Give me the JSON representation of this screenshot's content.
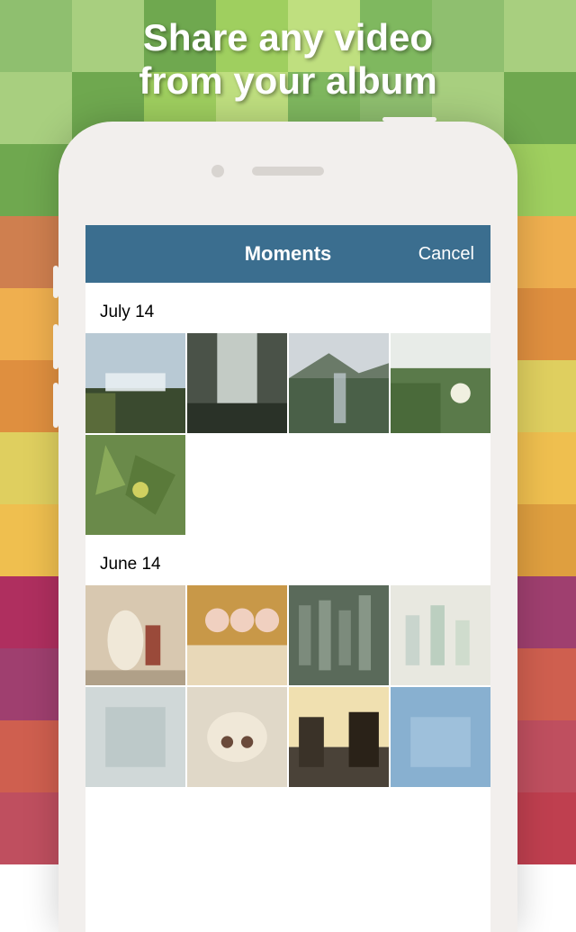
{
  "promo": {
    "line1": "Share any video",
    "line2": "from your album"
  },
  "navbar": {
    "title": "Moments",
    "cancel": "Cancel"
  },
  "sections": [
    {
      "label": "July 14"
    },
    {
      "label": "June 14"
    }
  ],
  "colors": {
    "navbar": "#3b6e8f",
    "phone": "#f2efed"
  }
}
